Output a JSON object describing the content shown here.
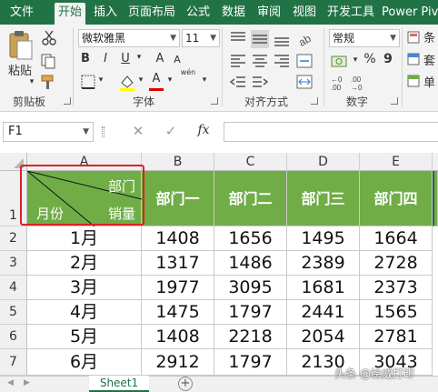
{
  "tabs": [
    {
      "label": "文件",
      "active": false
    },
    {
      "label": "开始",
      "active": true
    },
    {
      "label": "插入",
      "active": false
    },
    {
      "label": "页面布局",
      "active": false
    },
    {
      "label": "公式",
      "active": false
    },
    {
      "label": "数据",
      "active": false
    },
    {
      "label": "审阅",
      "active": false
    },
    {
      "label": "视图",
      "active": false
    },
    {
      "label": "开发工具",
      "active": false
    },
    {
      "label": "Power Piv",
      "active": false
    }
  ],
  "ribbon": {
    "paste_label": "粘贴",
    "clipboard_label": "剪贴板",
    "font_name": "微软雅黑",
    "font_size": "11",
    "font_group_label": "字体",
    "bold": "B",
    "italic": "I",
    "underline": "U",
    "font_grow": "A",
    "font_shrink": "A",
    "font_color_letter": "A",
    "wen": "wén",
    "align_group_label": "对齐方式",
    "number_format": "常规",
    "number_group_label": "数字",
    "percent": "%",
    "comma": "9",
    "right_cut_1": "条",
    "right_cut_2": "套",
    "right_cut_3": "单"
  },
  "formula_bar": {
    "name_box": "F1",
    "cancel": "✕",
    "enter": "✓",
    "fx": "fx",
    "content": ""
  },
  "columns": [
    "A",
    "B",
    "C",
    "D",
    "E"
  ],
  "rows": [
    "1",
    "2",
    "3",
    "4",
    "5",
    "6",
    "7"
  ],
  "header_cell": {
    "top_label": "部门",
    "mid_label": "销量",
    "bottom_label": "月份"
  },
  "departments": [
    "部门一",
    "部门二",
    "部门三",
    "部门四"
  ],
  "data_rows": [
    {
      "month": "1月",
      "values": [
        "1408",
        "1656",
        "1495",
        "1664"
      ]
    },
    {
      "month": "2月",
      "values": [
        "1317",
        "1486",
        "2389",
        "2728"
      ]
    },
    {
      "month": "3月",
      "values": [
        "1977",
        "3095",
        "1681",
        "2373"
      ]
    },
    {
      "month": "4月",
      "values": [
        "1475",
        "1797",
        "2441",
        "1565"
      ]
    },
    {
      "month": "5月",
      "values": [
        "1408",
        "2218",
        "2054",
        "2781"
      ]
    },
    {
      "month": "6月",
      "values": [
        "2912",
        "1797",
        "2130",
        "3043"
      ]
    }
  ],
  "sheet_tab": "Sheet1",
  "add_sheet": "+",
  "watermark": "头条 @绘威打印",
  "colors": {
    "excel_green": "#217346",
    "header_fill": "#70ad47",
    "highlight_red": "#e02020"
  }
}
